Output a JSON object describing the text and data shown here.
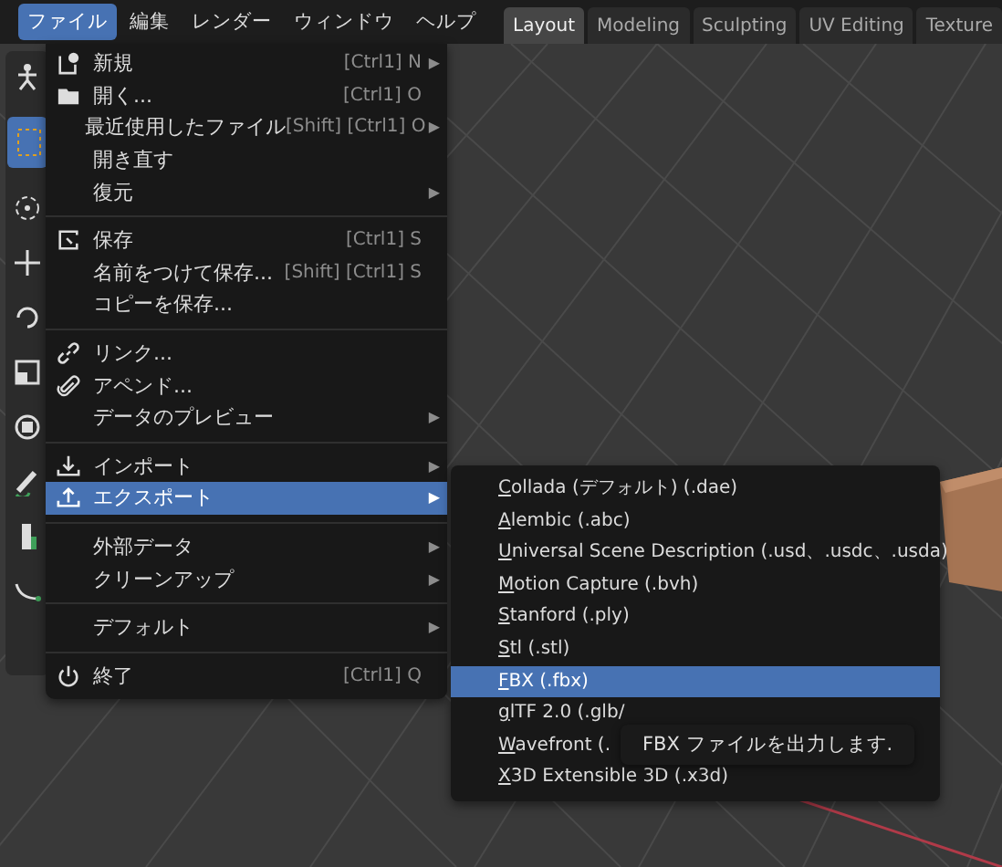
{
  "menubar": {
    "items": [
      {
        "label": "ファイル",
        "selected": true
      },
      {
        "label": "編集",
        "selected": false
      },
      {
        "label": "レンダー",
        "selected": false
      },
      {
        "label": "ウィンドウ",
        "selected": false
      },
      {
        "label": "ヘルプ",
        "selected": false
      }
    ]
  },
  "workspace_tabs": [
    {
      "label": "Layout",
      "selected": true
    },
    {
      "label": "Modeling",
      "selected": false
    },
    {
      "label": "Sculpting",
      "selected": false
    },
    {
      "label": "UV Editing",
      "selected": false
    },
    {
      "label": "Texture",
      "selected": false
    }
  ],
  "file_menu": {
    "sections": [
      {
        "items": [
          {
            "label": "新規",
            "shortcut": "[Ctrl1] N",
            "arrow": "▶",
            "selected": false
          },
          {
            "label": "開く...",
            "shortcut": "[Ctrl1] O",
            "selected": false
          },
          {
            "label": "最近使用したファイル",
            "shortcut": "[Shift] [Ctrl1] O",
            "arrow": "▶",
            "selected": false
          },
          {
            "label": "開き直す",
            "selected": false
          },
          {
            "label": "復元",
            "arrow": "▶",
            "selected": false
          }
        ]
      },
      {
        "items": [
          {
            "label": "保存",
            "shortcut": "[Ctrl1] S",
            "selected": false
          },
          {
            "label": "名前をつけて保存...",
            "shortcut": "[Shift] [Ctrl1] S",
            "selected": false
          },
          {
            "label": "コピーを保存...",
            "selected": false
          }
        ]
      },
      {
        "items": [
          {
            "label": "リンク...",
            "selected": false
          },
          {
            "label": "アペンド...",
            "selected": false
          },
          {
            "label": "データのプレビュー",
            "arrow": "▶",
            "selected": false
          }
        ]
      },
      {
        "items": [
          {
            "label": "インポート",
            "arrow": "▶",
            "selected": false
          },
          {
            "label": "エクスポート",
            "arrow": "▶",
            "selected": true
          }
        ]
      },
      {
        "items": [
          {
            "label": "外部データ",
            "arrow": "▶",
            "selected": false
          },
          {
            "label": "クリーンアップ",
            "arrow": "▶",
            "selected": false
          }
        ]
      },
      {
        "items": [
          {
            "label": "デフォルト",
            "arrow": "▶",
            "selected": false
          }
        ]
      },
      {
        "items": [
          {
            "label": "終了",
            "shortcut": "[Ctrl1] Q",
            "selected": false
          }
        ]
      }
    ]
  },
  "export_submenu": {
    "items": [
      {
        "label": "Collada (デフォルト) (.dae)",
        "selected": false
      },
      {
        "label": "Alembic (.abc)",
        "selected": false
      },
      {
        "label": "Universal Scene Description (.usd、.usdc、.usda)",
        "selected": false
      },
      {
        "label": "Motion Capture (.bvh)",
        "selected": false
      },
      {
        "label": "Stanford (.ply)",
        "selected": false
      },
      {
        "label": "Stl (.stl)",
        "selected": false
      },
      {
        "label": "FBX (.fbx)",
        "selected": true
      },
      {
        "label": "glTF 2.0 (.glb/",
        "selected": false
      },
      {
        "label": "Wavefront (.",
        "selected": false
      },
      {
        "label": "X3D Extensible 3D (.x3d)",
        "selected": false
      }
    ]
  },
  "tooltip": {
    "text": "FBX ファイルを出力します."
  }
}
